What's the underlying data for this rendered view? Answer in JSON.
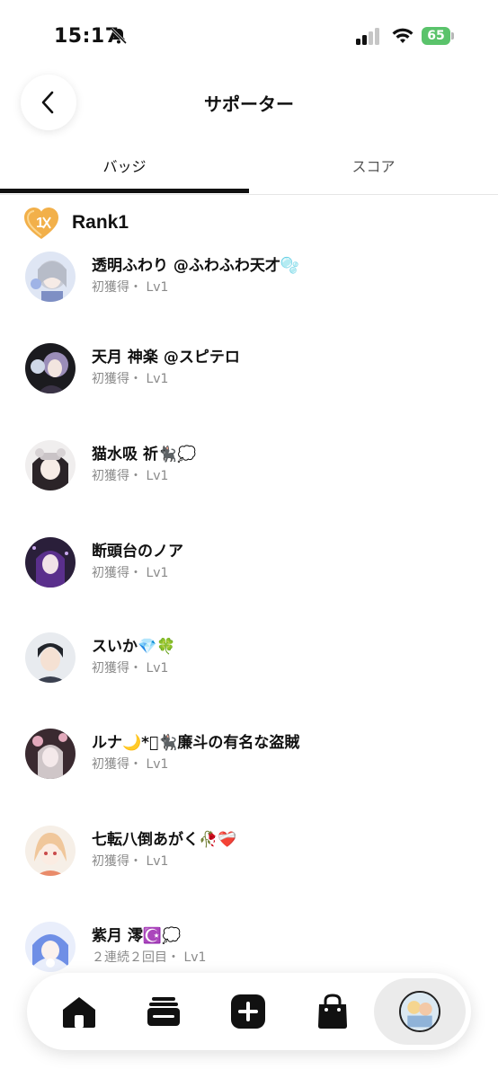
{
  "status_bar": {
    "time": "15:17",
    "battery": "65"
  },
  "header": {
    "title": "サポーター"
  },
  "tabs": [
    {
      "label": "バッジ"
    },
    {
      "label": "スコア"
    }
  ],
  "rank": {
    "badge_text": "1",
    "label": "Rank1"
  },
  "supporters": [
    {
      "name": "透明ふわり @ふわふわ天才",
      "emoji": "🫧",
      "sub": "初獲得・ Lv1"
    },
    {
      "name": "天月 神楽 @スピテロ",
      "emoji": "",
      "sub": "初獲得・ Lv1"
    },
    {
      "name": "猫水吸 祈",
      "emoji": "🐈‍⬛💭",
      "sub": "初獲得・ Lv1"
    },
    {
      "name": "断頭台のノア",
      "emoji": "",
      "sub": "初獲得・ Lv1"
    },
    {
      "name": "スいか",
      "emoji": "💎🍀",
      "sub": "初獲得・ Lv1"
    },
    {
      "name": "ルナ🌙*ﾟ🐈‍⬛廉斗の有名な盗賊",
      "emoji": "",
      "sub": "初獲得・ Lv1"
    },
    {
      "name": "七転八倒あがく",
      "emoji": "🥀❤️‍🩹",
      "sub": "初獲得・ Lv1"
    },
    {
      "name": "紫月 澪",
      "emoji": "☪️💭",
      "sub": "２連続２回目・ Lv1"
    }
  ],
  "colors": {
    "accent": "#111111",
    "rank_badge": "#f2b04a",
    "battery": "#5ac36b",
    "subtext": "#8a8a8a"
  },
  "nav": [
    {
      "icon": "home-icon"
    },
    {
      "icon": "cards-icon"
    },
    {
      "icon": "plus-icon"
    },
    {
      "icon": "shop-bag-icon"
    },
    {
      "icon": "profile-avatar"
    }
  ]
}
